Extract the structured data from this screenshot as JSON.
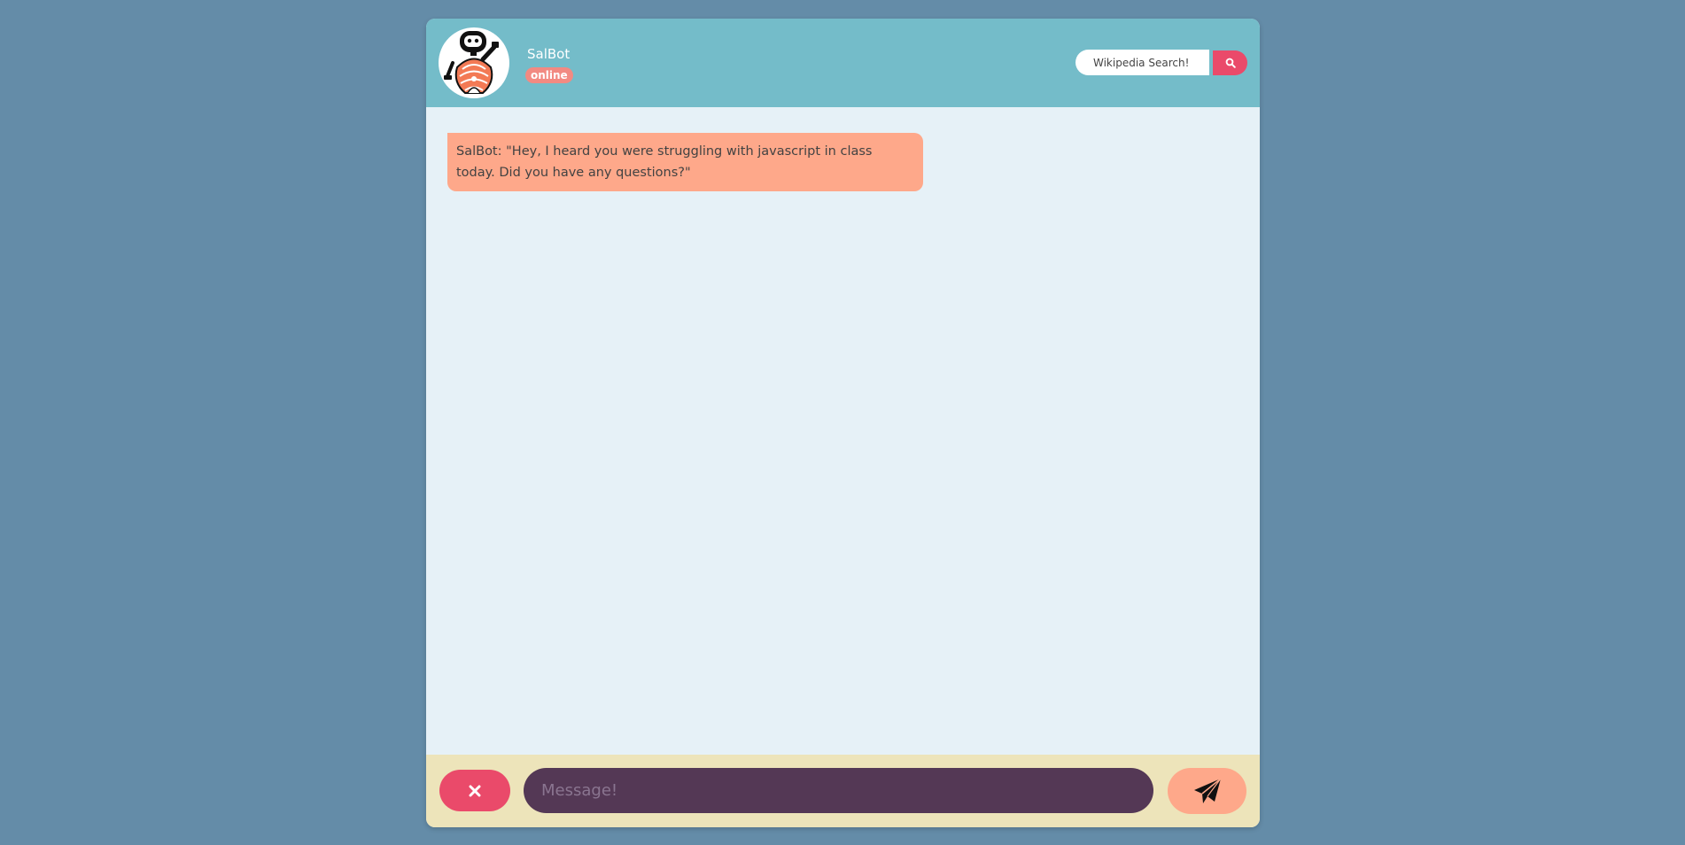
{
  "bot": {
    "name": "SalBot",
    "status": "online",
    "avatar_icon": "robot-icon"
  },
  "search": {
    "placeholder": "Wikipedia Search!",
    "button_icon": "search-icon"
  },
  "messages": [
    {
      "sender": "bot",
      "text": "SalBot: \"Hey, I heard you were struggling with javascript in class today. Did you have any questions?\""
    }
  ],
  "composer": {
    "placeholder": "Message!",
    "clear_icon": "close-icon",
    "send_icon": "paper-plane-icon"
  },
  "colors": {
    "page_background": "#648ca8",
    "header": "#74bcc9",
    "chat_background": "#e6f1f7",
    "status_badge": "#f28a82",
    "accent_pink": "#ea4a6a",
    "bot_bubble": "#fea88a",
    "footer": "#ede4ba",
    "message_input": "#543855"
  }
}
